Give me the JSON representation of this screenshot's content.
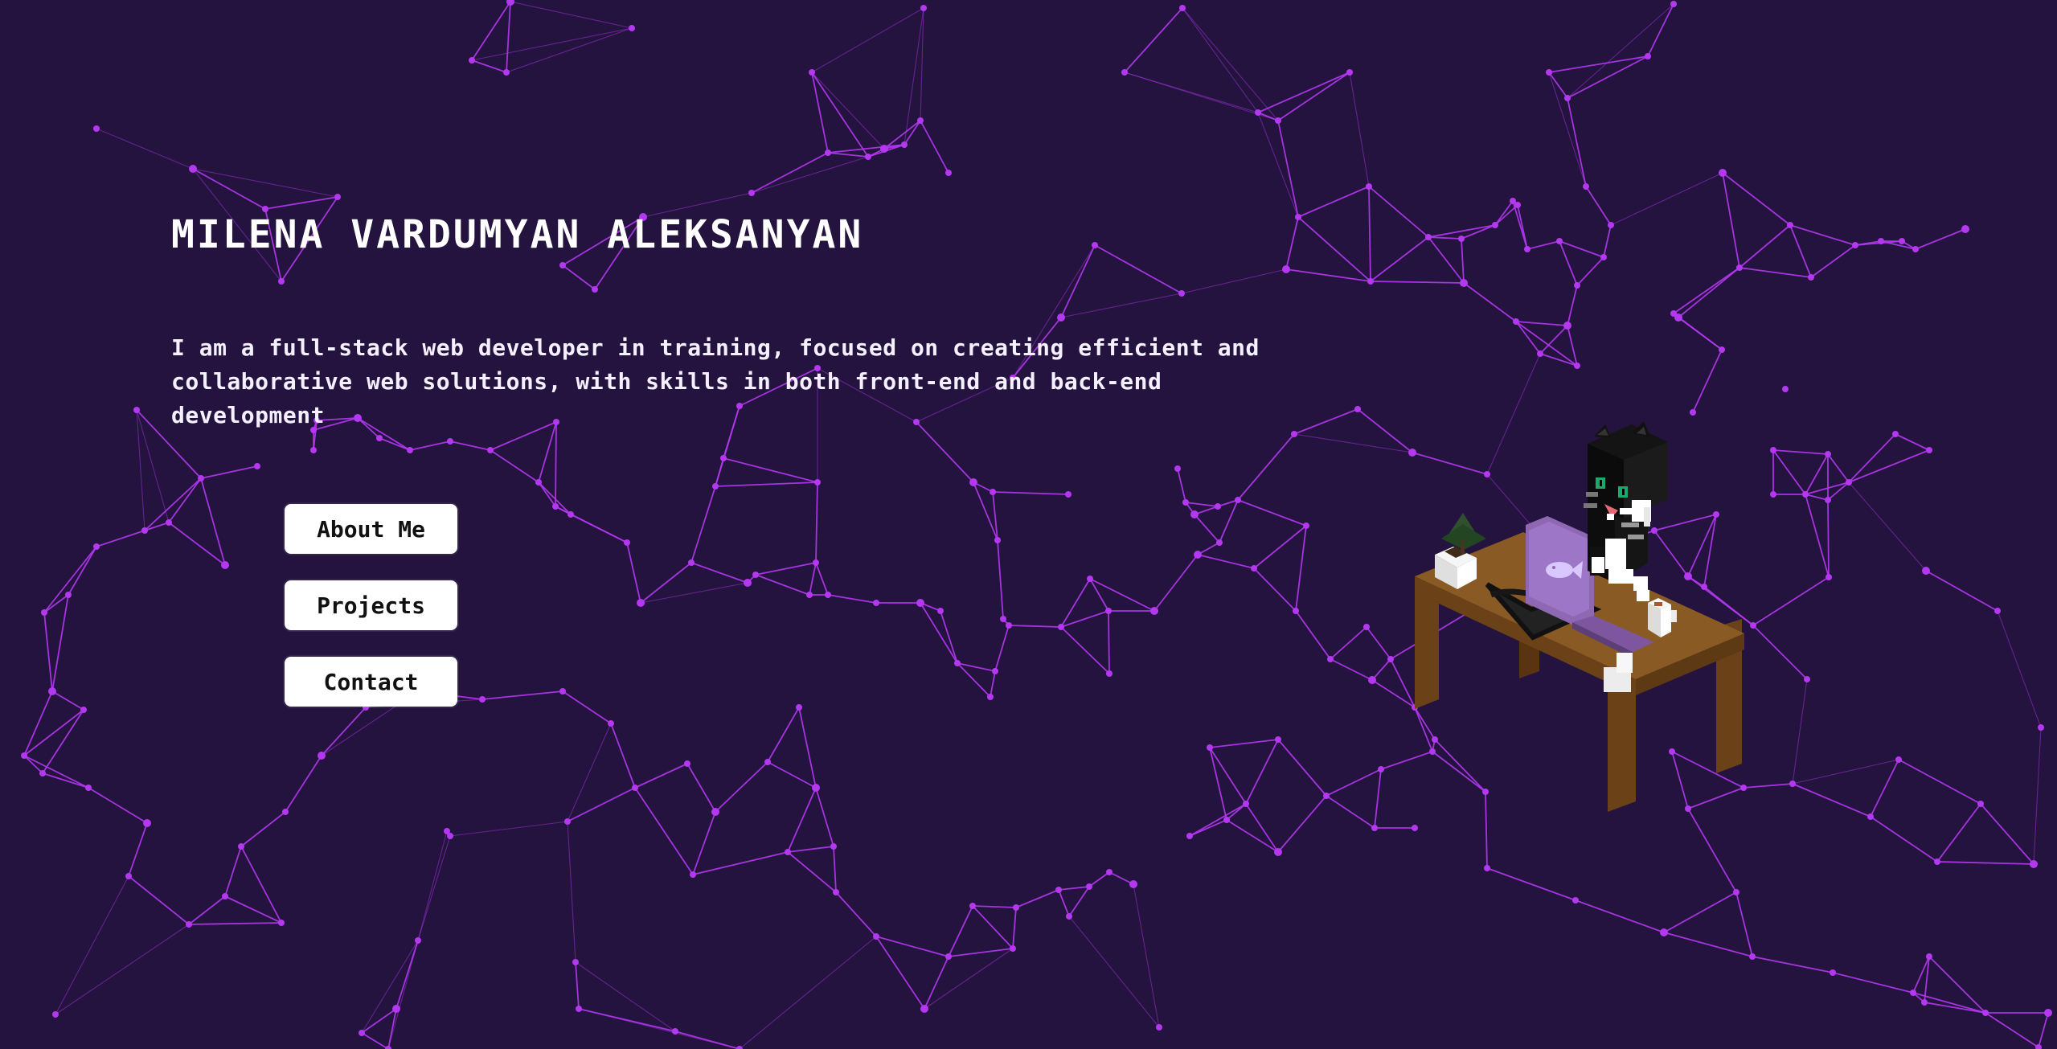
{
  "theme": {
    "background": "#23133e",
    "accent": "#b438f0"
  },
  "hero": {
    "title": "MILENA VARDUMYAN ALEKSANYAN",
    "intro_line_1": "I am a full-stack web developer in training, focused on creating efficient and",
    "intro_line_2": "collaborative web solutions, with skills in both front-end and back-end development"
  },
  "navigation": {
    "items": [
      {
        "label": "About Me"
      },
      {
        "label": "Projects"
      },
      {
        "label": "Contact"
      }
    ]
  },
  "illustration": {
    "name": "cat-at-desk-illustration",
    "icons": [
      "cat-icon",
      "laptop-icon",
      "fish-logo-icon",
      "plant-icon",
      "coffee-cup-icon"
    ]
  }
}
